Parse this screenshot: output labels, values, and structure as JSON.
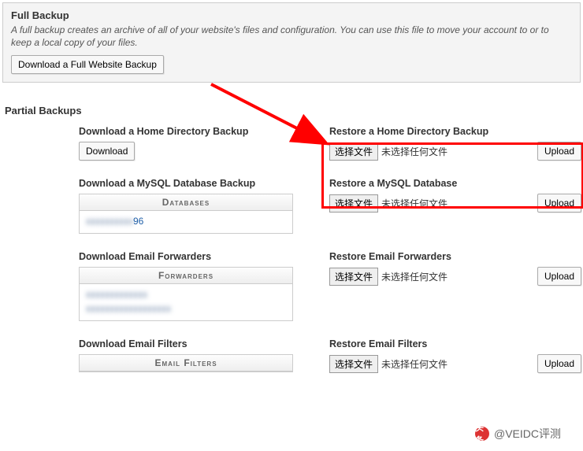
{
  "full_backup": {
    "title": "Full Backup",
    "desc": "A full backup creates an archive of all of your website's files and configuration. You can use this file to move your account to or to keep a local copy of your files.",
    "download_btn": "Download a Full Website Backup"
  },
  "partial_title": "Partial Backups",
  "sections": {
    "home": {
      "download_title": "Download a Home Directory Backup",
      "download_btn": "Download",
      "restore_title": "Restore a Home Directory Backup",
      "choose_label": "选择文件",
      "no_file": "未选择任何文件",
      "upload": "Upload"
    },
    "mysql": {
      "download_title": "Download a MySQL Database Backup",
      "panel_header": "Databases",
      "db_link_visible_suffix": "96",
      "restore_title": "Restore a MySQL Database",
      "choose_label": "选择文件",
      "no_file": "未选择任何文件",
      "upload": "Upload"
    },
    "forwarders": {
      "download_title": "Download Email Forwarders",
      "panel_header": "Forwarders",
      "restore_title": "Restore Email Forwarders",
      "choose_label": "选择文件",
      "no_file": "未选择任何文件",
      "upload": "Upload"
    },
    "filters": {
      "download_title": "Download Email Filters",
      "panel_header": "Email Filters",
      "restore_title": "Restore Email Filters",
      "choose_label": "选择文件",
      "no_file": "未选择任何文件",
      "upload": "Upload"
    }
  },
  "watermark": {
    "prefix": "头条",
    "text": "@VEIDC评测"
  }
}
